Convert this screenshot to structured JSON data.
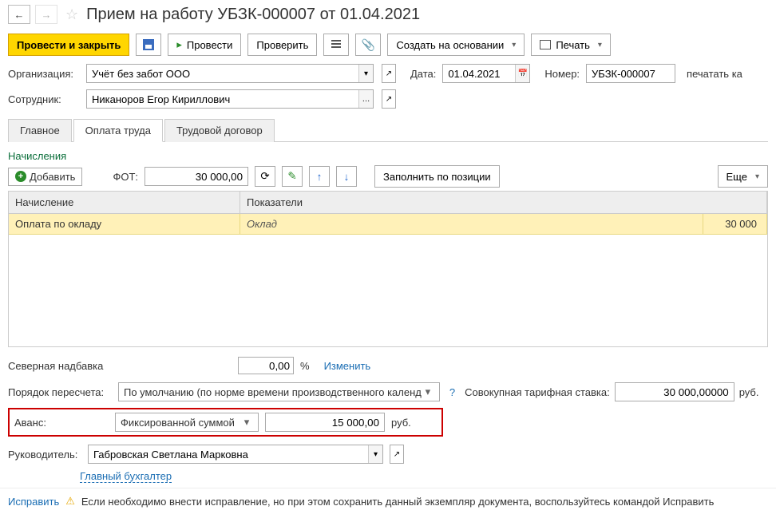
{
  "header": {
    "title": "Прием на работу УБЗК-000007 от 01.04.2021"
  },
  "toolbar": {
    "commit_close": "Провести и закрыть",
    "commit": "Провести",
    "check": "Проверить",
    "create_based": "Создать на основании",
    "print": "Печать"
  },
  "fields": {
    "org_label": "Организация:",
    "org_value": "Учёт без забот ООО",
    "date_label": "Дата:",
    "date_value": "01.04.2021",
    "number_label": "Номер:",
    "number_value": "УБЗК-000007",
    "print_option": "печатать ка",
    "employee_label": "Сотрудник:",
    "employee_value": "Никаноров Егор Кириллович"
  },
  "tabs": {
    "main": "Главное",
    "salary": "Оплата труда",
    "contract": "Трудовой договор"
  },
  "accruals": {
    "title": "Начисления",
    "add": "Добавить",
    "fot_label": "ФОТ:",
    "fot_value": "30 000,00",
    "fill_by_position": "Заполнить по позиции",
    "more": "Еще",
    "columns": {
      "name": "Начисление",
      "indicators": "Показатели"
    },
    "rows": [
      {
        "name": "Оплата по окладу",
        "indicator": "Оклад",
        "value": "30 000"
      }
    ]
  },
  "north": {
    "label": "Северная надбавка",
    "value": "0,00",
    "pct": "%",
    "change": "Изменить"
  },
  "recalc": {
    "label": "Порядок пересчета:",
    "value": "По умолчанию (по норме времени производственного календ",
    "help": "?",
    "total_label": "Совокупная тарифная ставка:",
    "total_value": "30 000,00000",
    "unit": "руб."
  },
  "avans": {
    "label": "Аванс:",
    "mode": "Фиксированной суммой",
    "value": "15 000,00",
    "unit": "руб."
  },
  "manager": {
    "label": "Руководитель:",
    "value": "Габровская Светлана Марковна",
    "position": "Главный бухгалтер"
  },
  "footer": {
    "fix": "Исправить",
    "note": "Если необходимо внести исправление, но при этом сохранить данный экземпляр документа, воспользуйтесь командой Исправить"
  }
}
